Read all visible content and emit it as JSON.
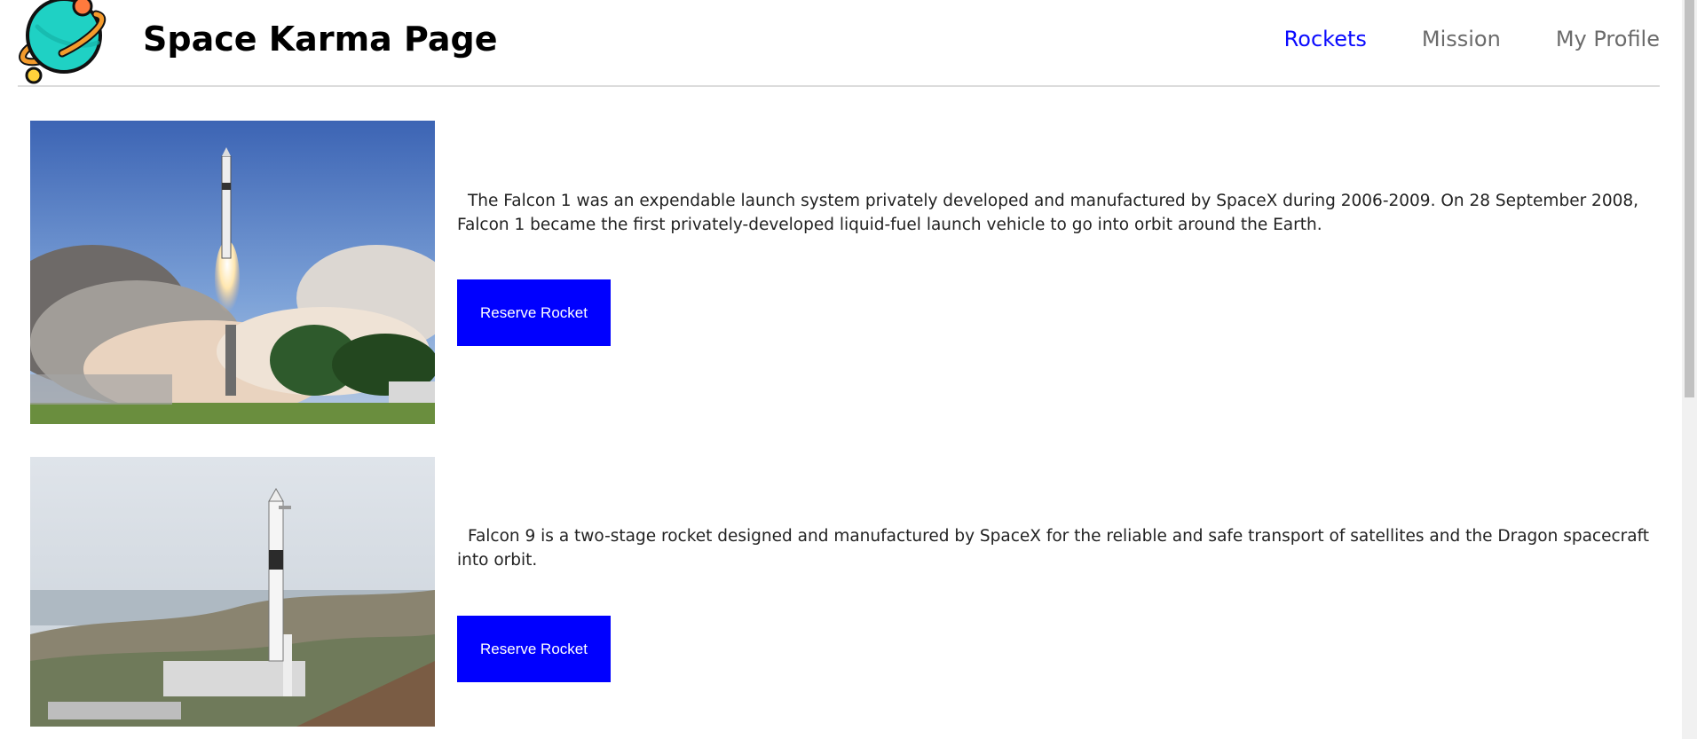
{
  "header": {
    "title": "Space Karma Page",
    "nav": [
      {
        "label": "Rockets",
        "active": true
      },
      {
        "label": "Mission",
        "active": false
      },
      {
        "label": "My Profile",
        "active": false
      }
    ]
  },
  "rockets": [
    {
      "description": "The Falcon 1 was an expendable launch system privately developed and manufactured by SpaceX during 2006-2009. On 28 September 2008, Falcon 1 became the first privately-developed liquid-fuel launch vehicle to go into orbit around the Earth.",
      "button_label": "Reserve Rocket"
    },
    {
      "description": "Falcon 9 is a two-stage rocket designed and manufactured by SpaceX for the reliable and safe transport of satellites and the Dragon spacecraft into orbit.",
      "button_label": "Reserve Rocket"
    }
  ],
  "colors": {
    "accent": "#0000ff",
    "nav_active": "#0a0aff",
    "nav_inactive": "#6b6b6b",
    "logo_planet": "#1fd1c4",
    "logo_moon": "#ffb43b"
  }
}
